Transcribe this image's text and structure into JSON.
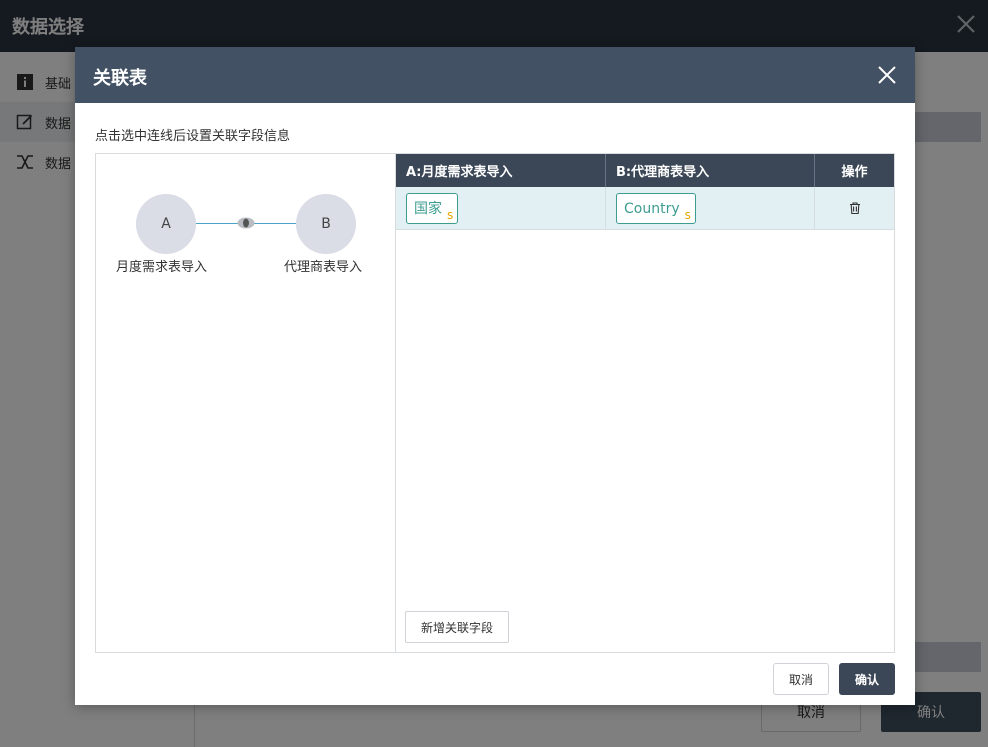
{
  "background": {
    "title": "数据选择",
    "nav": [
      {
        "label": "基础",
        "icon": "info-icon"
      },
      {
        "label": "数据",
        "icon": "edit-icon"
      },
      {
        "label": "数据",
        "icon": "shuffle-icon"
      }
    ],
    "cancel_label": "取消",
    "confirm_label": "确认"
  },
  "modal": {
    "title": "关联表",
    "hint": "点击选中连线后设置关联字段信息",
    "diagram": {
      "node_a": {
        "letter": "A",
        "label": "月度需求表导入"
      },
      "node_b": {
        "letter": "B",
        "label": "代理商表导入"
      }
    },
    "table": {
      "headers": [
        "A:月度需求表导入",
        "B:代理商表导入",
        "操作"
      ],
      "rows": [
        {
          "a_field": "国家",
          "a_type": "s",
          "b_field": "Country",
          "b_type": "s"
        }
      ]
    },
    "add_label": "新增关联字段",
    "cancel_label": "取消",
    "confirm_label": "确认"
  },
  "colors": {
    "header": "#425163",
    "table_header": "#3b4757",
    "row_highlight": "#e2eff3",
    "field_tag": "#3c9c90",
    "type_tag": "#e6a700"
  }
}
